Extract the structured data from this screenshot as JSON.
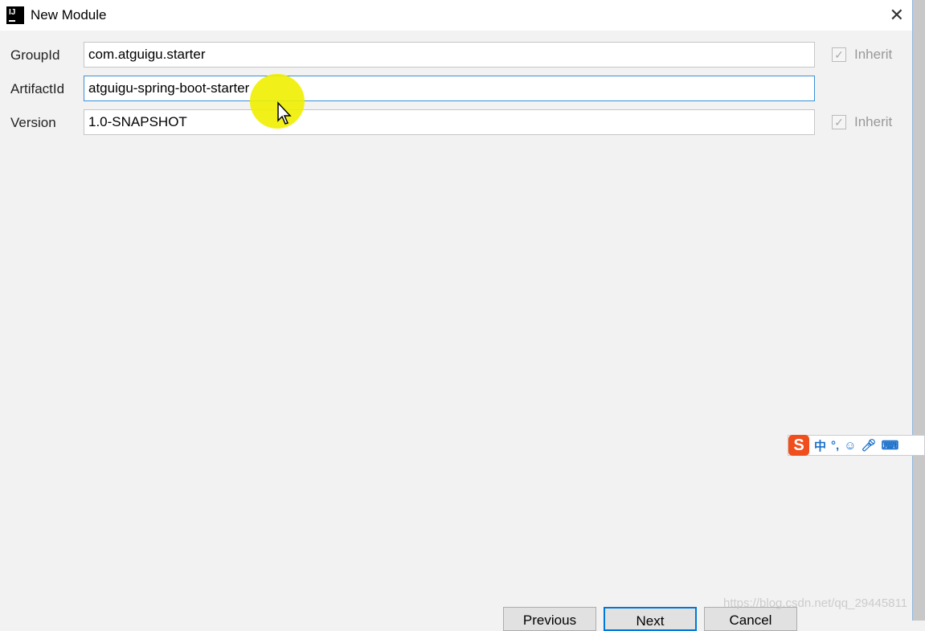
{
  "window": {
    "title": "New Module",
    "close_icon": "close-icon"
  },
  "fields": [
    {
      "label": "GroupId",
      "value": "com.atguigu.starter",
      "inherit": "Inherit",
      "inherit_checked": true
    },
    {
      "label": "ArtifactId",
      "value": "atguigu-spring-boot-starter"
    },
    {
      "label": "Version",
      "value": "1.0-SNAPSHOT",
      "inherit": "Inherit",
      "inherit_checked": true
    }
  ],
  "buttons": {
    "previous": "Previous",
    "next": "Next",
    "cancel": "Cancel"
  },
  "ime": {
    "logo": "S",
    "mode": "中",
    "punct": "°,"
  },
  "watermark": "https://blog.csdn.net/qq_29445811"
}
